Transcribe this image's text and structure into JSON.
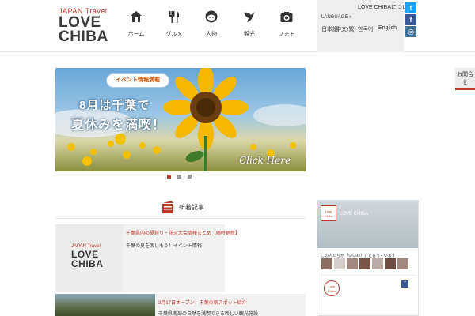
{
  "header": {
    "logo": {
      "tagline": "JAPAN Travel",
      "line1": "LOVE",
      "line2": "CHIBA"
    },
    "nav": [
      {
        "label": "ホーム",
        "icon": "home-icon"
      },
      {
        "label": "グルメ",
        "icon": "fork-knife-icon"
      },
      {
        "label": "人物",
        "icon": "face-icon"
      },
      {
        "label": "観光",
        "icon": "bird-icon"
      },
      {
        "label": "フォト",
        "icon": "camera-icon"
      }
    ],
    "site_link": "LOVE CHIBAについて",
    "language": {
      "title": "LANGUAGE »",
      "options": [
        "日本語",
        "中文(繁)",
        "한국어",
        "English"
      ]
    },
    "social": [
      {
        "icon": "twitter-icon",
        "glyph": "t",
        "color": "#1da1f2"
      },
      {
        "icon": "facebook-icon",
        "glyph": "f",
        "color": "#3b5998"
      },
      {
        "icon": "instagram-icon",
        "glyph": "◎",
        "color": "#3f729b"
      }
    ]
  },
  "side_tab": {
    "line1": "お問合",
    "line2": "せ"
  },
  "hero": {
    "bubble": "イベント情報満載",
    "headline1": "8月は千葉で",
    "headline2": "夏休みを満喫！",
    "cta": "Click Here"
  },
  "slider": {
    "count": 3,
    "active_index": 0,
    "active_color": "#c0392b",
    "inactive_color": "#999999"
  },
  "section": {
    "title": "新着記事"
  },
  "articles": [
    {
      "logo": {
        "tagline": "JAPAN Travel",
        "line1": "LOVE",
        "line2": "CHIBA"
      },
      "title": "千葉県内の夏祭り・花火大会情報まとめ【随時更新】",
      "excerpt": "千葉の夏を楽しもう！イベント情報"
    },
    {
      "title": "3月17日オープン！千葉の新スポット紹介",
      "excerpt": "千葉県南部の自然を満喫できる新しい観光施設"
    }
  ],
  "facebook": {
    "page_name": "LOVE CHIBA",
    "likes_text": "この人たちが「いいね！」と言っています",
    "profile_text": "Love Chiba"
  },
  "colors": {
    "accent": "#c0392b",
    "panel": "#eeeeee"
  }
}
